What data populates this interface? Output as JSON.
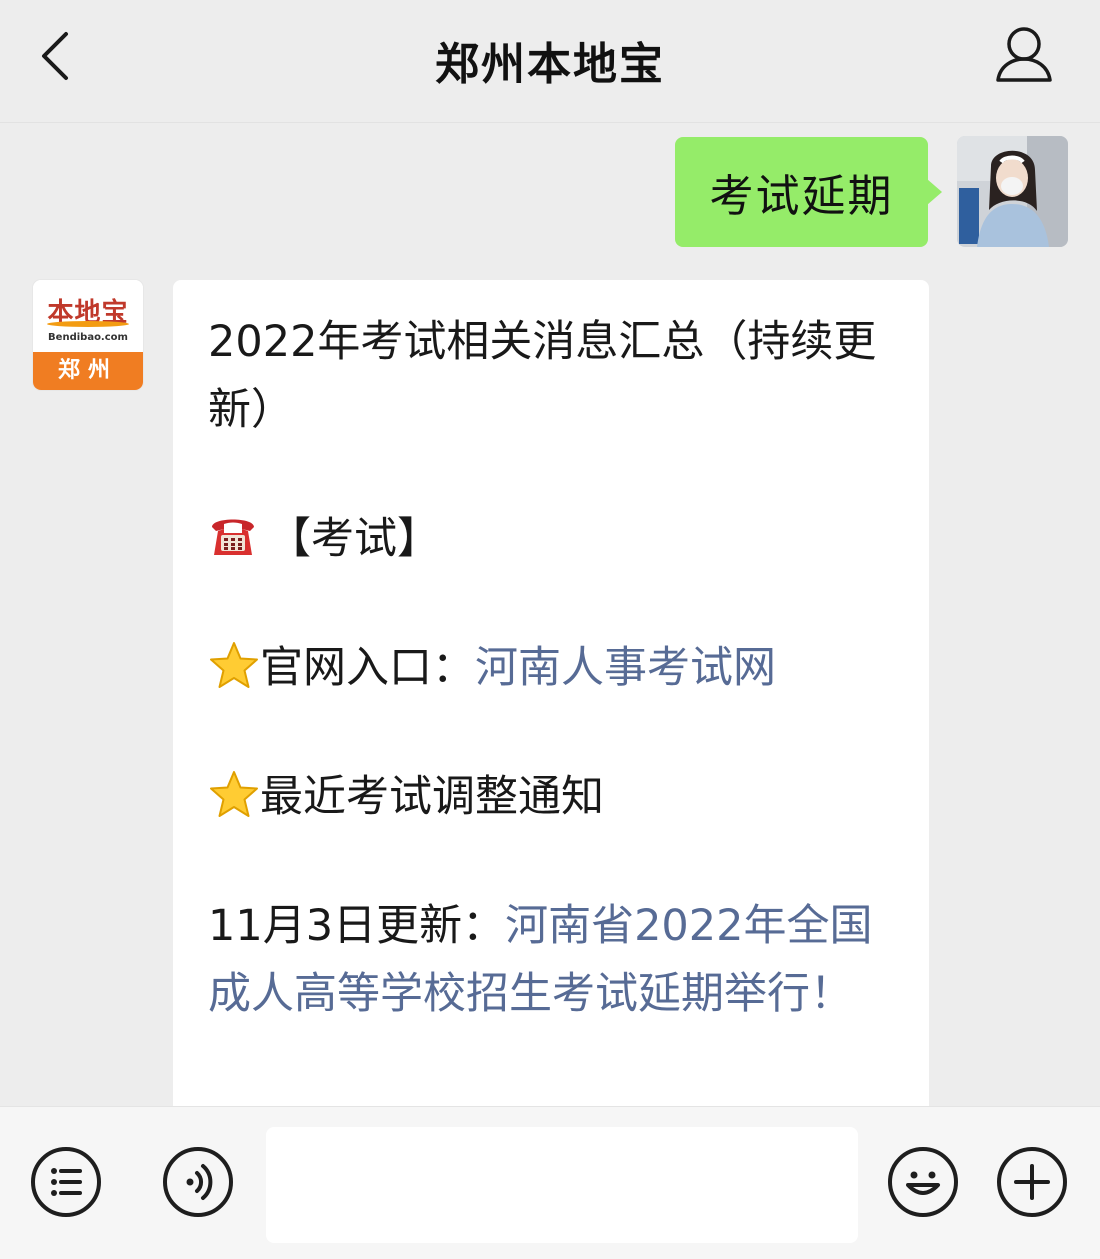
{
  "header": {
    "title": "郑州本地宝",
    "back_icon": "chevron-left-icon",
    "profile_icon": "person-icon"
  },
  "sent_message": {
    "text": "考试延期"
  },
  "bot": {
    "avatar_brand": "本地宝",
    "avatar_site": "Bendibao.com",
    "avatar_city": "郑州",
    "brand_color": "#f07d22"
  },
  "received_message": {
    "heading": "2022年考试相关消息汇总（持续更新）",
    "section_label": "【考试】",
    "section_icon": "telephone-icon",
    "official_prefix": "官网入口：",
    "official_link": "河南人事考试网",
    "recent_label": "最近考试调整通知",
    "update_prefix": "11月3日更新：",
    "update_link": "河南省2022年全国成人高等学校招生考试延期举行！",
    "star_icon": "star-icon"
  },
  "input_bar": {
    "menu_icon": "list-menu-icon",
    "voice_icon": "voice-icon",
    "emoji_icon": "smiley-icon",
    "plus_icon": "plus-icon",
    "input_value": ""
  },
  "colors": {
    "sent_bubble": "#95ec69",
    "link": "#576b95",
    "background": "#ededed"
  }
}
